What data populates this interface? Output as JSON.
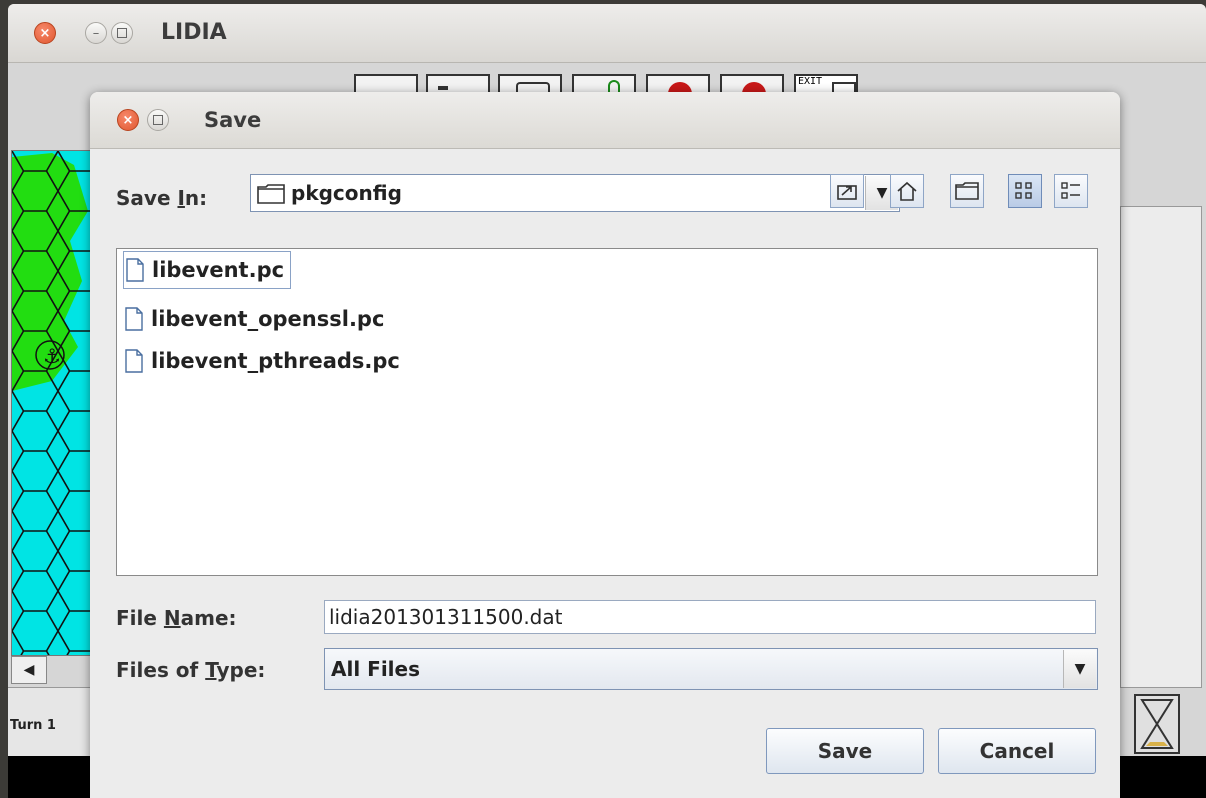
{
  "main_window": {
    "title": "LIDIA",
    "toolbar": {
      "exit_label": "EXIT"
    },
    "status": {
      "turn": "Turn 1"
    }
  },
  "dialog": {
    "title": "Save",
    "save_in": {
      "label_pre": "Save ",
      "label_mnemonic": "I",
      "label_post": "n:",
      "value": "pkgconfig"
    },
    "nav_buttons": [
      {
        "name": "up-one-level-icon"
      },
      {
        "name": "home-icon"
      },
      {
        "name": "new-folder-icon"
      },
      {
        "name": "list-view-icon"
      },
      {
        "name": "details-view-icon"
      }
    ],
    "files": [
      {
        "name": "libevent.pc",
        "selected": true
      },
      {
        "name": "libevent_openssl.pc",
        "selected": false
      },
      {
        "name": "libevent_pthreads.pc",
        "selected": false
      }
    ],
    "file_name": {
      "label_pre": "File ",
      "label_mnemonic": "N",
      "label_post": "ame:",
      "value": "lidia201301311500.dat"
    },
    "file_type": {
      "label_pre": "Files of ",
      "label_mnemonic": "T",
      "label_post": "ype:",
      "value": "All Files"
    },
    "buttons": {
      "save": "Save",
      "cancel": "Cancel"
    }
  },
  "colors": {
    "accent_border": "#7e93b3",
    "map_water": "#00e4e4",
    "map_land": "#22dd11",
    "close_button": "#e0572f"
  }
}
